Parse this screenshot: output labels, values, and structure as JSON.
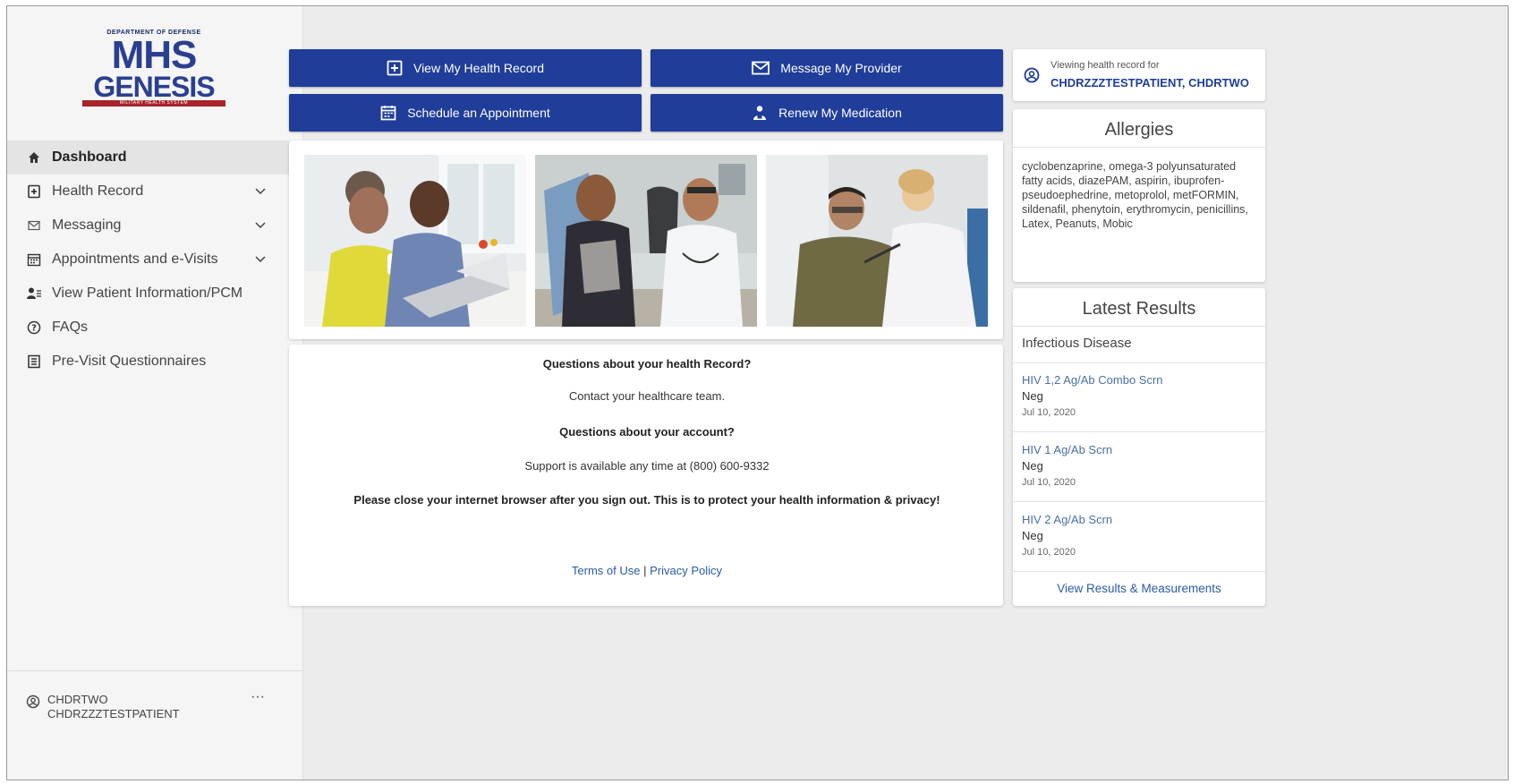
{
  "logo": {
    "top_text": "DEPARTMENT OF DEFENSE",
    "mhs": "MHS",
    "genesis": "GENESIS",
    "bar_text": "MILITARY HEALTH SYSTEM"
  },
  "sidebar": {
    "items": [
      {
        "label": "Dashboard",
        "icon": "home-icon"
      },
      {
        "label": "Health Record",
        "icon": "health-record-icon"
      },
      {
        "label": "Messaging",
        "icon": "envelope-icon"
      },
      {
        "label": "Appointments and e-Visits",
        "icon": "calendar-icon"
      },
      {
        "label": "View Patient Information/PCM",
        "icon": "patient-info-icon"
      },
      {
        "label": "FAQs",
        "icon": "question-icon"
      },
      {
        "label": "Pre-Visit Questionnaires",
        "icon": "questionnaire-icon"
      }
    ],
    "user": {
      "first": "CHDRTWO",
      "last": "CHDRZZZTESTPATIENT",
      "more": "···"
    }
  },
  "actions": {
    "view_record": "View My Health Record",
    "message_provider": "Message My Provider",
    "schedule": "Schedule an Appointment",
    "renew": "Renew My Medication"
  },
  "info": {
    "q1": "Questions about your health Record?",
    "a1": "Contact your healthcare team.",
    "q2": "Questions about your account?",
    "a2": "Support is available any time at (800) 600-9332",
    "notice": "Please close your internet browser after you sign out. This is to protect your health information & privacy!",
    "terms": "Terms of Use",
    "separator": "|",
    "privacy": "Privacy Policy"
  },
  "viewing": {
    "label": "Viewing health record for",
    "name": "CHDRZZZTESTPATIENT, CHDRTWO"
  },
  "allergies": {
    "title": "Allergies",
    "text": "cyclobenzaprine, omega-3 polyunsaturated fatty acids, diazePAM, aspirin, ibuprofen-pseudoephedrine, metoprolol, metFORMIN, sildenafil, phenytoin, erythromycin, penicillins, Latex, Peanuts, Mobic"
  },
  "results": {
    "title": "Latest Results",
    "category": "Infectious Disease",
    "items": [
      {
        "name": "HIV 1,2 Ag/Ab Combo Scrn",
        "value": "Neg",
        "date": "Jul 10, 2020"
      },
      {
        "name": "HIV 1 Ag/Ab Scrn",
        "value": "Neg",
        "date": "Jul 10, 2020"
      },
      {
        "name": "HIV 2 Ag/Ab Scrn",
        "value": "Neg",
        "date": "Jul 10, 2020"
      }
    ],
    "view_all": "View Results & Measurements"
  },
  "colors": {
    "primary": "#1f3d99",
    "link": "#2a5aa8",
    "background": "#ececec"
  }
}
